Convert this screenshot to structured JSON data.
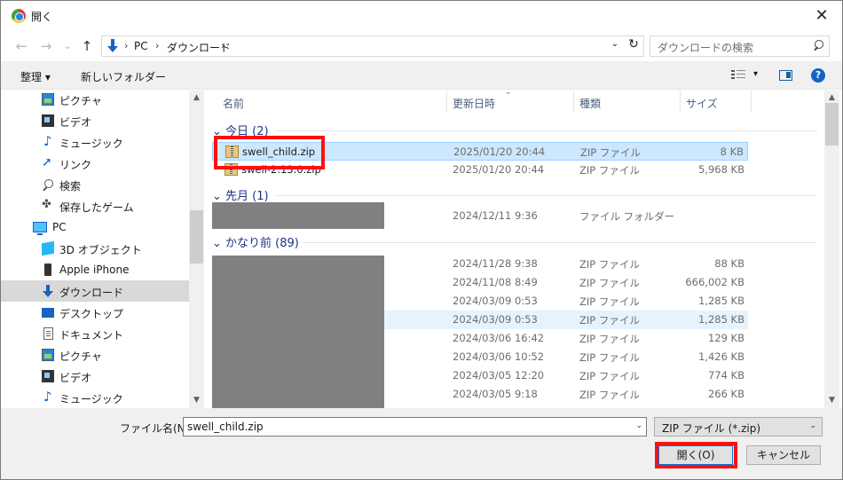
{
  "window": {
    "title": "開く",
    "close_glyph": "✕"
  },
  "nav": {
    "back_glyph": "←",
    "forward_glyph": "→",
    "recent_glyph": "⌄",
    "up_glyph": "↑",
    "breadcrumbs": [
      "PC",
      "ダウンロード"
    ],
    "crumb_sep": "›",
    "dropdown_glyph": "⌄",
    "refresh_glyph": "↻",
    "search_placeholder": "ダウンロードの検索"
  },
  "toolbar": {
    "organize": "整理 ▾",
    "new_folder": "新しいフォルダー",
    "view_drop": "▾",
    "help": "?"
  },
  "sidebar": {
    "items": [
      {
        "label": "ピクチャ",
        "icon": "pictures-icon"
      },
      {
        "label": "ビデオ",
        "icon": "video-icon"
      },
      {
        "label": "ミュージック",
        "icon": "music-icon"
      },
      {
        "label": "リンク",
        "icon": "link-icon"
      },
      {
        "label": "検索",
        "icon": "search-icon"
      },
      {
        "label": "保存したゲーム",
        "icon": "game-icon"
      },
      {
        "label": "PC",
        "icon": "pc-icon"
      },
      {
        "label": "3D オブジェクト",
        "icon": "3d-objects-icon"
      },
      {
        "label": "Apple iPhone",
        "icon": "phone-icon"
      },
      {
        "label": "ダウンロード",
        "icon": "downloads-icon"
      },
      {
        "label": "デスクトップ",
        "icon": "desktop-icon"
      },
      {
        "label": "ドキュメント",
        "icon": "documents-icon"
      },
      {
        "label": "ピクチャ",
        "icon": "pictures-icon"
      },
      {
        "label": "ビデオ",
        "icon": "video-icon"
      },
      {
        "label": "ミュージック",
        "icon": "music-icon"
      }
    ],
    "selected": "ダウンロード"
  },
  "columns": {
    "name": "名前",
    "date": "更新日時",
    "type": "種類",
    "size": "サイズ"
  },
  "groups": [
    {
      "label": "⌄ 今日 (2)"
    },
    {
      "label": "⌄ 先月 (1)"
    },
    {
      "label": "⌄ かなり前 (89)"
    }
  ],
  "rows": [
    {
      "name": "swell_child.zip",
      "date": "2025/01/20 20:44",
      "type": "ZIP ファイル",
      "size": "8 KB"
    },
    {
      "name": "swell-2.13.0.zip",
      "date": "2025/01/20 20:44",
      "type": "ZIP ファイル",
      "size": "5,968 KB"
    },
    {
      "name": "",
      "date": "2024/12/11 9:36",
      "type": "ファイル フォルダー",
      "size": ""
    },
    {
      "name": "",
      "date": "2024/11/28 9:38",
      "type": "ZIP ファイル",
      "size": "88 KB"
    },
    {
      "name": "",
      "date": "2024/11/08 8:49",
      "type": "ZIP ファイル",
      "size": "666,002 KB"
    },
    {
      "name": "",
      "date": "2024/03/09 0:53",
      "type": "ZIP ファイル",
      "size": "1,285 KB"
    },
    {
      "name": "",
      "date": "2024/03/09 0:53",
      "type": "ZIP ファイル",
      "size": "1,285 KB"
    },
    {
      "name": "",
      "date": "2024/03/06 16:42",
      "type": "ZIP ファイル",
      "size": "129 KB"
    },
    {
      "name": "",
      "date": "2024/03/06 10:52",
      "type": "ZIP ファイル",
      "size": "1,426 KB"
    },
    {
      "name": "",
      "date": "2024/03/05 12:20",
      "type": "ZIP ファイル",
      "size": "774 KB"
    },
    {
      "name": "",
      "date": "2024/03/05 9:18",
      "type": "ZIP ファイル",
      "size": "266 KB"
    }
  ],
  "bottom": {
    "filename_label": "ファイル名(N):",
    "filename_value": "swell_child.zip",
    "filetype_value": "ZIP ファイル (*.zip)",
    "open_button": "開く(O)",
    "cancel_button": "キャンセル",
    "drop_glyph": "⌄"
  },
  "colors": {
    "selected_row": "#cce8ff",
    "highlight": "#ff1010",
    "group_text": "#1e3287"
  }
}
